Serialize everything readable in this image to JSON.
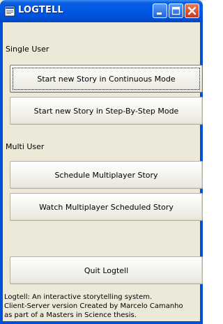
{
  "window": {
    "title": "LOGTELL",
    "app_icon": "app-icon",
    "controls": [
      "minimize-icon",
      "maximize-icon",
      "close-icon"
    ],
    "title_bar_color": "#0058e6",
    "close_color": "#c43a1a"
  },
  "single_user": {
    "heading": "Single User",
    "continuous_label": "Start new Story in Continuous Mode",
    "step_label": "Start new Story in Step-By-Step Mode"
  },
  "multi_user": {
    "heading": "Multi User",
    "schedule_label": "Schedule Multiplayer Story",
    "watch_label": "Watch Multiplayer Scheduled Story"
  },
  "quit_label": "Quit Logtell",
  "footer": {
    "line1": "Logtell: An interactive storytelling system.",
    "line2": "Client-Server version Created by Marcelo Camanho",
    "line3": "as part of a Masters in Science thesis."
  }
}
